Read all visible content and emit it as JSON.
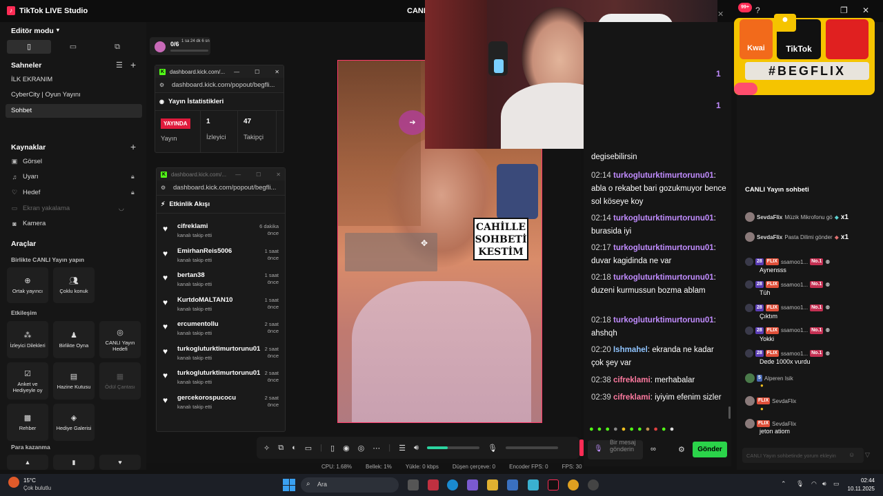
{
  "app": {
    "title": "TikTok LIVE Studio",
    "center_title": "CANLI"
  },
  "editor": {
    "mode_label": "Editör modu",
    "scenes_title": "Sahneler",
    "scenes": [
      {
        "label": "İLK EKRANIM"
      },
      {
        "label": "CyberCity | Oyun Yayını"
      },
      {
        "label": "Sohbet"
      }
    ],
    "sources_title": "Kaynaklar",
    "sources": [
      {
        "label": "Görsel",
        "icon": "image-icon"
      },
      {
        "label": "Uyarı",
        "icon": "bell-icon"
      },
      {
        "label": "Hedef",
        "icon": "heart-icon"
      },
      {
        "label": "Ekran yakalama",
        "icon": "monitor-icon"
      },
      {
        "label": "Kamera",
        "icon": "camera-icon"
      }
    ],
    "tools_title": "Araçlar",
    "group1_title": "Birlikte CANLI Yayın yapın",
    "group1": [
      {
        "label": "Ortak yayıncı"
      },
      {
        "label": "Çoklu konuk"
      }
    ],
    "group2_title": "Etkileşim",
    "group2": [
      {
        "label": "İzleyici Dilekleri"
      },
      {
        "label": "Birlikte Oyna"
      },
      {
        "label": "CANLI Yayın Hedefi"
      },
      {
        "label": "Anket ve Hediyeyle oy"
      },
      {
        "label": "Hazine Kutusu"
      },
      {
        "label": "Ödül Çantası"
      },
      {
        "label": "Rehber"
      },
      {
        "label": "Hediye Galerisi"
      }
    ],
    "group3_title": "Para kazanma"
  },
  "goal_widget": {
    "value": "0/6",
    "timer": "1 sa 24 dk 6 sn"
  },
  "stats_popup": {
    "tab": "dashboard.kick.com/...",
    "url": "dashboard.kick.com/popout/begfli...",
    "title": "Yayın İstatistikleri",
    "live_badge": "YAYINDA",
    "status_label": "Yayın",
    "viewers_value": "1",
    "viewers_label": "İzleyici",
    "followers_value": "47",
    "followers_label": "Takipçi"
  },
  "events_popup": {
    "tab": "dashboard.kick.com/...",
    "url": "dashboard.kick.com/popout/begfli...",
    "title": "Etkinlik Akışı",
    "events": [
      {
        "name": "cifreklami",
        "sub": "kanalı takip etti",
        "time": "6 dakika önce"
      },
      {
        "name": "EmirhanReis5006",
        "sub": "kanalı takip etti",
        "time": "1 saat önce"
      },
      {
        "name": "bertan38",
        "sub": "kanalı takip etti",
        "time": "1 saat önce"
      },
      {
        "name": "KurtdoMALTAN10",
        "sub": "kanalı takip etti",
        "time": "1 saat önce"
      },
      {
        "name": "ercumentollu",
        "sub": "kanalı takip etti",
        "time": "2 saat önce"
      },
      {
        "name": "turkogluturktimurtorunu01",
        "sub": "kanalı takip etti",
        "time": "2 saat önce"
      },
      {
        "name": "turkogluturktimurtorunu01",
        "sub": "kanalı takip etti",
        "time": "2 saat önce"
      },
      {
        "name": "gercekorospucocu",
        "sub": "kanalı takip etti",
        "time": "2 saat önce"
      }
    ]
  },
  "overlay": {
    "sticker_line1": "CAHİLLE",
    "sticker_line2": "SOHBETİ",
    "sticker_line3": "KESTİM",
    "banner_hashtag": "#BEGFLIX",
    "kwai": "Kwai",
    "tiktok": "TikTok",
    "notif": "99+"
  },
  "chat": {
    "partial_top": "degisebilirsin",
    "messages": [
      {
        "time": "02:14",
        "user": "turkogluturktimurtorunu01",
        "text": ": abla o rekabet bari gozukmuyor bence sol köseye koy",
        "color": "purple"
      },
      {
        "time": "02:14",
        "user": "turkogluturktimurtorunu01",
        "text": ": burasida iyi",
        "color": "purple"
      },
      {
        "time": "02:17",
        "user": "turkogluturktimurtorunu01",
        "text": ": duvar kagidinda ne var",
        "color": "purple"
      },
      {
        "time": "02:18",
        "user": "turkogluturktimurtorunu01",
        "text": ": duzeni kurmussun bozma ablam",
        "color": "purple"
      },
      {
        "time": "02:18",
        "user": "turkogluturktimurtorunu01",
        "text": ": ahshqh",
        "color": "purple"
      },
      {
        "time": "02:20",
        "user": "Ishmahel",
        "text": ": ekranda ne kadar çok şey var",
        "color": "blue"
      },
      {
        "time": "02:38",
        "user": "cifreklami",
        "text": ": merhabalar",
        "color": "pink"
      },
      {
        "time": "02:39",
        "user": "cifreklami",
        "text": ": iyiyim efenim sizler",
        "color": "pink"
      }
    ],
    "input_placeholder": "Bir mesaj gönderin",
    "send_label": "Gönder"
  },
  "live_chat": {
    "title": "CANLI Yayın sohbeti",
    "gifts": [
      {
        "user": "SevdaFlix",
        "text": "Müzik Mikrofonu gö",
        "count": "x1"
      },
      {
        "user": "SevdaFlix",
        "text": "Pasta Dilimi gönder",
        "count": "x1"
      }
    ],
    "messages": [
      {
        "level": "28",
        "badge": "FLIX",
        "user": "ssamoo1...",
        "rank": "No.1",
        "text": "Aynensss"
      },
      {
        "level": "28",
        "badge": "FLIX",
        "user": "ssamoo1...",
        "rank": "No.1",
        "text": "Tüh"
      },
      {
        "level": "28",
        "badge": "FLIX",
        "user": "ssamoo1...",
        "rank": "No.1",
        "text": "Çıktım"
      },
      {
        "level": "28",
        "badge": "FLIX",
        "user": "ssamoo1...",
        "rank": "No.1",
        "text": "Yokki"
      },
      {
        "level": "28",
        "badge": "FLIX",
        "user": "ssamoo1...",
        "rank": "No.1",
        "text": "Dede 1000x vurdu"
      }
    ],
    "alperen": {
      "level": "5",
      "user": "Alperen Isik"
    },
    "sevda1": {
      "badge": "FLIX",
      "user": "SevdaFlix"
    },
    "sevda2": {
      "badge": "FLIX",
      "user": "SevdaFlix",
      "text": "jeton atiom"
    },
    "input_placeholder": "CANLI Yayın sohbetinde yorum ekleyin"
  },
  "status_bar": {
    "cpu": "CPU: 1.68%",
    "memory": "Bellek: 1%",
    "upload": "Yükle: 0 kbps",
    "dropped": "Düşen çerçeve: 0",
    "encoder": "Encoder FPS: 0",
    "fps": "FPS: 30"
  },
  "taskbar": {
    "weather_temp": "15°C",
    "weather_desc": "Çok bulutlu",
    "search_placeholder": "Ara",
    "time": "02:44",
    "date": "10.11.2025"
  },
  "colors": {
    "accent": "#fe2c55",
    "kick_green": "#53fc18",
    "send_green": "#2bd44a"
  }
}
